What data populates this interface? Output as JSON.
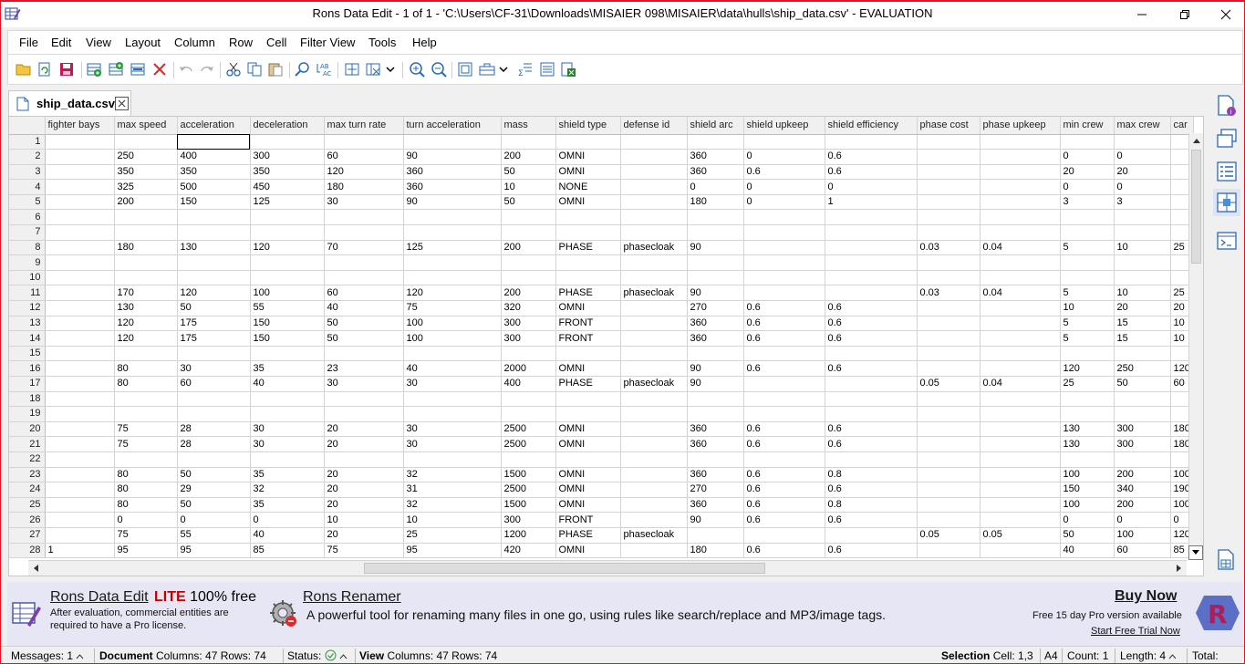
{
  "window": {
    "title": "Rons Data Edit - 1 of 1 - 'C:\\Users\\CF-31\\Downloads\\MISAIER 098\\MISAIER\\data\\hulls\\ship_data.csv' - EVALUATION"
  },
  "menu": [
    "File",
    "Edit",
    "View",
    "Layout",
    "Column",
    "Row",
    "Cell",
    "Filter View",
    "Tools",
    "Help"
  ],
  "tab": {
    "label": "ship_data.csv"
  },
  "grid": {
    "columns": [
      "",
      "fighter bays",
      "max speed",
      "acceleration",
      "deceleration",
      "max turn rate",
      "turn acceleration",
      "mass",
      "shield type",
      "defense id",
      "shield arc",
      "shield upkeep",
      "shield efficiency",
      "phase cost",
      "phase upkeep",
      "min crew",
      "max crew",
      "car"
    ],
    "rows": [
      [
        "1",
        "",
        "",
        "",
        "",
        "",
        "",
        "",
        "",
        "",
        "",
        "",
        "",
        "",
        "",
        "",
        "",
        ""
      ],
      [
        "2",
        "",
        "250",
        "400",
        "300",
        "60",
        "90",
        "200",
        "OMNI",
        "",
        "360",
        "0",
        "0.6",
        "",
        "",
        "0",
        "0",
        ""
      ],
      [
        "3",
        "",
        "350",
        "350",
        "350",
        "120",
        "360",
        "50",
        "OMNI",
        "",
        "360",
        "0.6",
        "0.6",
        "",
        "",
        "20",
        "20",
        ""
      ],
      [
        "4",
        "",
        "325",
        "500",
        "450",
        "180",
        "360",
        "10",
        "NONE",
        "",
        "0",
        "0",
        "0",
        "",
        "",
        "0",
        "0",
        ""
      ],
      [
        "5",
        "",
        "200",
        "150",
        "125",
        "30",
        "90",
        "50",
        "OMNI",
        "",
        "180",
        "0",
        "1",
        "",
        "",
        "3",
        "3",
        ""
      ],
      [
        "6",
        "",
        "",
        "",
        "",
        "",
        "",
        "",
        "",
        "",
        "",
        "",
        "",
        "",
        "",
        "",
        "",
        ""
      ],
      [
        "7",
        "",
        "",
        "",
        "",
        "",
        "",
        "",
        "",
        "",
        "",
        "",
        "",
        "",
        "",
        "",
        "",
        ""
      ],
      [
        "8",
        "",
        "180",
        "130",
        "120",
        "70",
        "125",
        "200",
        "PHASE",
        "phasecloak",
        "90",
        "",
        "",
        "0.03",
        "0.04",
        "5",
        "10",
        "25"
      ],
      [
        "9",
        "",
        "",
        "",
        "",
        "",
        "",
        "",
        "",
        "",
        "",
        "",
        "",
        "",
        "",
        "",
        "",
        ""
      ],
      [
        "10",
        "",
        "",
        "",
        "",
        "",
        "",
        "",
        "",
        "",
        "",
        "",
        "",
        "",
        "",
        "",
        "",
        ""
      ],
      [
        "11",
        "",
        "170",
        "120",
        "100",
        "60",
        "120",
        "200",
        "PHASE",
        "phasecloak",
        "90",
        "",
        "",
        "0.03",
        "0.04",
        "5",
        "10",
        "25"
      ],
      [
        "12",
        "",
        "130",
        "50",
        "55",
        "40",
        "75",
        "320",
        "OMNI",
        "",
        "270",
        "0.6",
        "0.6",
        "",
        "",
        "10",
        "20",
        "20"
      ],
      [
        "13",
        "",
        "120",
        "175",
        "150",
        "50",
        "100",
        "300",
        "FRONT",
        "",
        "360",
        "0.6",
        "0.6",
        "",
        "",
        "5",
        "15",
        "10"
      ],
      [
        "14",
        "",
        "120",
        "175",
        "150",
        "50",
        "100",
        "300",
        "FRONT",
        "",
        "360",
        "0.6",
        "0.6",
        "",
        "",
        "5",
        "15",
        "10"
      ],
      [
        "15",
        "",
        "",
        "",
        "",
        "",
        "",
        "",
        "",
        "",
        "",
        "",
        "",
        "",
        "",
        "",
        "",
        ""
      ],
      [
        "16",
        "",
        "80",
        "30",
        "35",
        "23",
        "40",
        "2000",
        "OMNI",
        "",
        "90",
        "0.6",
        "0.6",
        "",
        "",
        "120",
        "250",
        "120"
      ],
      [
        "17",
        "",
        "80",
        "60",
        "40",
        "30",
        "30",
        "400",
        "PHASE",
        "phasecloak",
        "90",
        "",
        "",
        "0.05",
        "0.04",
        "25",
        "50",
        "60"
      ],
      [
        "18",
        "",
        "",
        "",
        "",
        "",
        "",
        "",
        "",
        "",
        "",
        "",
        "",
        "",
        "",
        "",
        "",
        ""
      ],
      [
        "19",
        "",
        "",
        "",
        "",
        "",
        "",
        "",
        "",
        "",
        "",
        "",
        "",
        "",
        "",
        "",
        "",
        ""
      ],
      [
        "20",
        "",
        "75",
        "28",
        "30",
        "20",
        "30",
        "2500",
        "OMNI",
        "",
        "360",
        "0.6",
        "0.6",
        "",
        "",
        "130",
        "300",
        "180"
      ],
      [
        "21",
        "",
        "75",
        "28",
        "30",
        "20",
        "30",
        "2500",
        "OMNI",
        "",
        "360",
        "0.6",
        "0.6",
        "",
        "",
        "130",
        "300",
        "180"
      ],
      [
        "22",
        "",
        "",
        "",
        "",
        "",
        "",
        "",
        "",
        "",
        "",
        "",
        "",
        "",
        "",
        "",
        "",
        ""
      ],
      [
        "23",
        "",
        "80",
        "50",
        "35",
        "20",
        "32",
        "1500",
        "OMNI",
        "",
        "360",
        "0.6",
        "0.8",
        "",
        "",
        "100",
        "200",
        "100"
      ],
      [
        "24",
        "",
        "80",
        "29",
        "32",
        "20",
        "31",
        "2500",
        "OMNI",
        "",
        "270",
        "0.6",
        "0.6",
        "",
        "",
        "150",
        "340",
        "190"
      ],
      [
        "25",
        "",
        "80",
        "50",
        "35",
        "20",
        "32",
        "1500",
        "OMNI",
        "",
        "360",
        "0.6",
        "0.8",
        "",
        "",
        "100",
        "200",
        "100"
      ],
      [
        "26",
        "",
        "0",
        "0",
        "0",
        "10",
        "10",
        "300",
        "FRONT",
        "",
        "90",
        "0.6",
        "0.6",
        "",
        "",
        "0",
        "0",
        "0"
      ],
      [
        "27",
        "",
        "75",
        "55",
        "40",
        "20",
        "25",
        "1200",
        "PHASE",
        "phasecloak",
        "",
        "",
        "",
        "0.05",
        "0.05",
        "50",
        "100",
        "120"
      ],
      [
        "28",
        "1",
        "95",
        "95",
        "85",
        "75",
        "95",
        "420",
        "OMNI",
        "",
        "180",
        "0.6",
        "0.6",
        "",
        "",
        "40",
        "60",
        "85"
      ]
    ]
  },
  "banner": {
    "product": "Rons Data Edit",
    "edition": "LITE",
    "free": "100% free",
    "line1": "After evaluation, commercial entities are",
    "line2": "required to have a Pro license.",
    "renamer_title": "Rons Renamer",
    "renamer_text": "A powerful tool for renaming many files in one go, using rules like search/replace and MP3/image tags.",
    "buy_now": "Buy Now",
    "trial_text": "Free 15 day Pro version available",
    "trial_link": "Start Free Trial Now"
  },
  "status": {
    "messages": "Messages: 1",
    "document_label": "Document",
    "document_info": "Columns: 47 Rows: 74",
    "status_label": "Status:",
    "view_label": "View",
    "view_info": "Columns: 47 Rows: 74",
    "selection_label": "Selection",
    "cell": "Cell: 1,3",
    "cell_ref": "A4",
    "count": "Count: 1",
    "length": "Length: 4",
    "total": "Total:"
  }
}
